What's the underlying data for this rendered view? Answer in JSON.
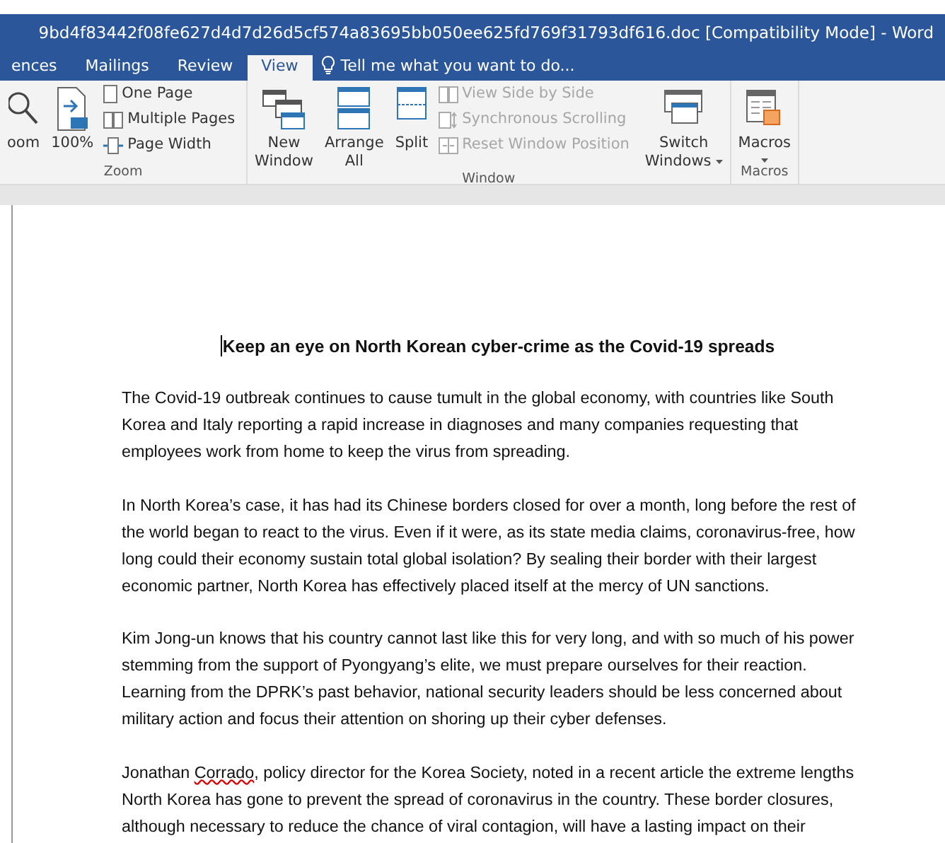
{
  "window": {
    "title": "9bd4f83442f08fe627d4d7d26d5cf574a83695bb050ee625fd769f31793df616.doc [Compatibility Mode] - Word"
  },
  "tabs": [
    {
      "label": "ences",
      "selected": false
    },
    {
      "label": "Mailings",
      "selected": false
    },
    {
      "label": "Review",
      "selected": false
    },
    {
      "label": "View",
      "selected": true
    }
  ],
  "tell_me": {
    "placeholder": "Tell me what you want to do..."
  },
  "ribbon": {
    "groups": [
      {
        "label": "Zoom",
        "items": [
          {
            "kind": "large",
            "lines": [
              "oom"
            ]
          },
          {
            "kind": "large",
            "lines": [
              "100%"
            ]
          },
          {
            "kind": "stack",
            "entries": [
              {
                "label": "One Page",
                "disabled": false
              },
              {
                "label": "Multiple Pages",
                "disabled": false
              },
              {
                "label": "Page Width",
                "disabled": false
              }
            ]
          }
        ]
      },
      {
        "label": "Window",
        "items": [
          {
            "kind": "large",
            "lines": [
              "New",
              "Window"
            ]
          },
          {
            "kind": "large",
            "lines": [
              "Arrange",
              "All"
            ]
          },
          {
            "kind": "large",
            "lines": [
              "Split"
            ]
          },
          {
            "kind": "stack",
            "entries": [
              {
                "label": "View Side by Side",
                "disabled": true
              },
              {
                "label": "Synchronous Scrolling",
                "disabled": true
              },
              {
                "label": "Reset Window Position",
                "disabled": true
              }
            ]
          },
          {
            "kind": "large",
            "lines": [
              "Switch",
              "Windows"
            ],
            "dropdown": true
          }
        ]
      },
      {
        "label": "Macros",
        "items": [
          {
            "kind": "large",
            "lines": [
              "Macros"
            ],
            "dropdown": true
          }
        ]
      }
    ]
  },
  "document": {
    "title": "Keep an eye on North Korean cyber-crime as the Covid-19 spreads",
    "paragraphs": [
      [
        {
          "text": "The Covid-19 outbreak continues to cause tumult in the global economy, with countries like South Korea and Italy reporting a rapid increase in diagnoses and many companies requesting that employees work from home to keep the virus from spreading.",
          "misspelled": false
        }
      ],
      [
        {
          "text": "In North Korea’s case, it has had its Chinese borders closed for over a month, long before the rest of the world began to react to the virus. Even if it were, as its state media claims, coronavirus-free, how long could their economy sustain total global isolation? By sealing their border with their largest economic partner, North Korea has effectively placed itself at the mercy of UN sanctions.",
          "misspelled": false
        }
      ],
      [
        {
          "text": "Kim Jong-un knows that his country cannot last like this for very long, and with so much of his power stemming from the support of Pyongyang’s elite, we must prepare ourselves for their reaction. Learning from the DPRK’s past behavior, national security leaders should be less concerned about military action and focus their attention on shoring up their cyber defenses.",
          "misspelled": false
        }
      ],
      [
        {
          "text": "Jonathan ",
          "misspelled": false
        },
        {
          "text": "Corrado",
          "misspelled": true
        },
        {
          "text": ", policy director for the Korea Society, noted in a recent article the extreme lengths North Korea has gone to prevent the spread of coronavirus in the country. These border closures, although necessary to reduce the chance of viral contagion, will have a lasting impact on their",
          "misspelled": false
        }
      ]
    ]
  }
}
